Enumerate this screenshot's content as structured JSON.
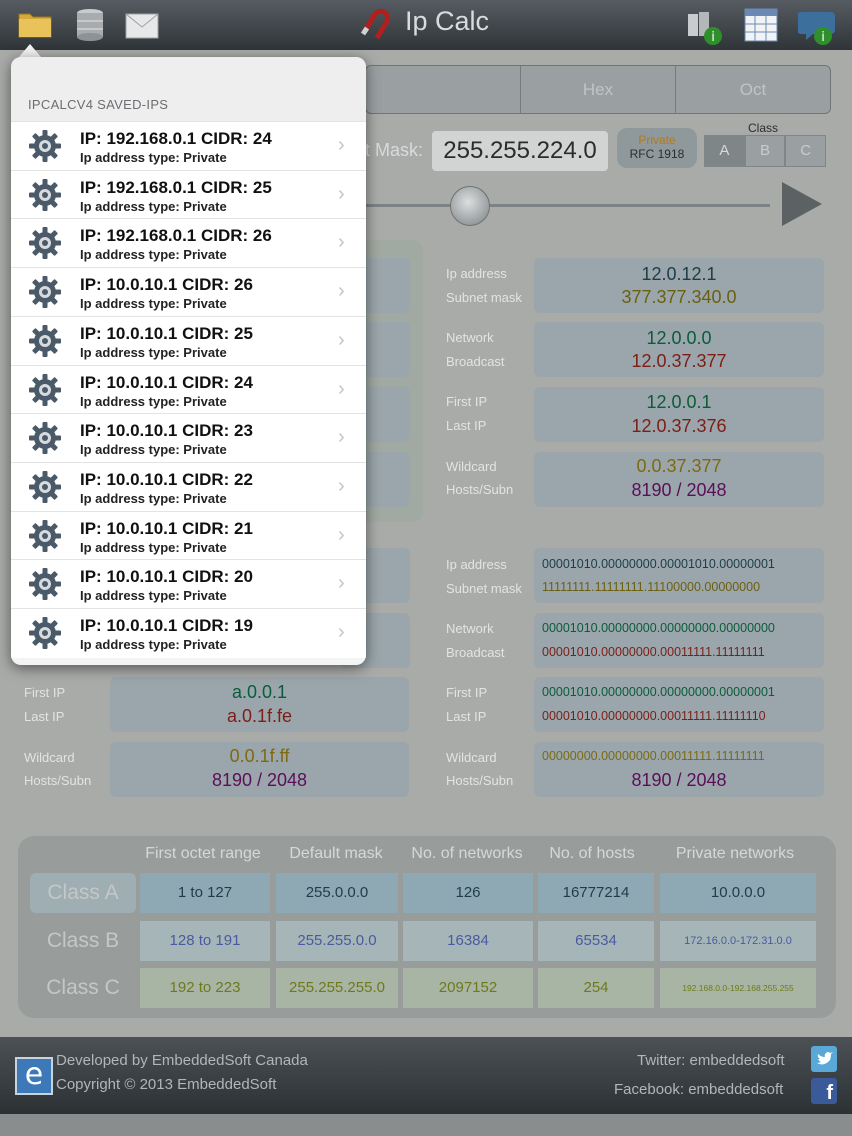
{
  "toolbar": {
    "title": "Ip Calc",
    "left_icons": [
      "folder-icon",
      "database-icon",
      "envelope-icon"
    ],
    "right_icons": [
      "books-info-icon",
      "table-icon",
      "chat-info-icon"
    ]
  },
  "tabs": [
    "Hex",
    "Oct"
  ],
  "mask": {
    "label": "t Mask:",
    "value": "255.255.224.0"
  },
  "private_badge": {
    "line1": "Private",
    "line2": "RFC 1918"
  },
  "class_selector": {
    "label": "Class",
    "options": [
      "A",
      "B",
      "C"
    ],
    "selected": "A"
  },
  "oct_values": [
    {
      "label1": "Ip address",
      "value1": "12.0.12.1",
      "label2": "Subnet mask",
      "value2": "377.377.340.0"
    },
    {
      "label1": "Network",
      "value1": "12.0.0.0",
      "label2": "Broadcast",
      "value2": "12.0.37.377"
    },
    {
      "label1": "First IP",
      "value1": "12.0.0.1",
      "label2": "Last IP",
      "value2": "12.0.37.376"
    },
    {
      "label1": "Wildcard",
      "value1": "0.0.37.377",
      "label2": "Hosts/Subn",
      "value2": "8190 / 2048"
    }
  ],
  "bin_values": [
    {
      "label1": "Ip address",
      "value1": "00001010.00000000.00001010.00000001",
      "label2": "Subnet mask",
      "value2": "11111111.11111111.11100000.00000000"
    },
    {
      "label1": "Network",
      "value1": "00001010.00000000.00000000.00000000",
      "label2": "Broadcast",
      "value2": "00001010.00000000.00011111.11111111"
    },
    {
      "label1": "First IP",
      "value1": "00001010.00000000.00000000.00000001",
      "label2": "Last IP",
      "value2": "00001010.00000000.00011111.11111110"
    },
    {
      "label1": "Wildcard",
      "value1": "00000000.00000000.00011111.11111111",
      "label2": "Hosts/Subn",
      "value2": "8190 / 2048"
    }
  ],
  "hex_values": [
    {
      "label1": "First IP",
      "value1": "a.0.0.1",
      "label2": "Last IP",
      "value2": "a.0.1f.fe"
    },
    {
      "label1": "Wildcard",
      "value1": "0.0.1f.ff",
      "label2": "Hosts/Subn",
      "value2": "8190 / 2048"
    }
  ],
  "class_table": {
    "headers": [
      "First octet range",
      "Default mask",
      "No. of networks",
      "No. of hosts",
      "Private networks"
    ],
    "rows": [
      {
        "name": "Class A",
        "cells": [
          "1 to 127",
          "255.0.0.0",
          "126",
          "16777214",
          "10.0.0.0"
        ]
      },
      {
        "name": "Class B",
        "cells": [
          "128 to 191",
          "255.255.0.0",
          "16384",
          "65534",
          "172.16.0.0-172.31.0.0"
        ]
      },
      {
        "name": "Class C",
        "cells": [
          "192 to 223",
          "255.255.255.0",
          "2097152",
          "254",
          "192.168.0.0-192.168.255.255"
        ]
      }
    ]
  },
  "footer": {
    "developer": "Developed by EmbeddedSoft Canada",
    "copyright": "Copyright © 2013 EmbeddedSoft",
    "twitter": "Twitter: embeddedsoft",
    "facebook": "Facebook: embeddedsoft",
    "logo_letter": "e"
  },
  "popover": {
    "title": "IPCALCV4 SAVED-IPS",
    "items": [
      {
        "main": "IP: 192.168.0.1 CIDR: 24",
        "sub": "Ip address type: Private"
      },
      {
        "main": "IP: 192.168.0.1 CIDR: 25",
        "sub": "Ip address type: Private"
      },
      {
        "main": "IP: 192.168.0.1 CIDR: 26",
        "sub": "Ip address type: Private"
      },
      {
        "main": "IP: 10.0.10.1 CIDR: 26",
        "sub": "Ip address type: Private"
      },
      {
        "main": "IP: 10.0.10.1 CIDR: 25",
        "sub": "Ip address type: Private"
      },
      {
        "main": "IP: 10.0.10.1 CIDR: 24",
        "sub": "Ip address type: Private"
      },
      {
        "main": "IP: 10.0.10.1 CIDR: 23",
        "sub": "Ip address type: Private"
      },
      {
        "main": "IP: 10.0.10.1 CIDR: 22",
        "sub": "Ip address type: Private"
      },
      {
        "main": "IP: 10.0.10.1 CIDR: 21",
        "sub": "Ip address type: Private"
      },
      {
        "main": "IP: 10.0.10.1 CIDR: 20",
        "sub": "Ip address type: Private"
      },
      {
        "main": "IP: 10.0.10.1 CIDR: 19",
        "sub": "Ip address type: Private"
      }
    ]
  }
}
